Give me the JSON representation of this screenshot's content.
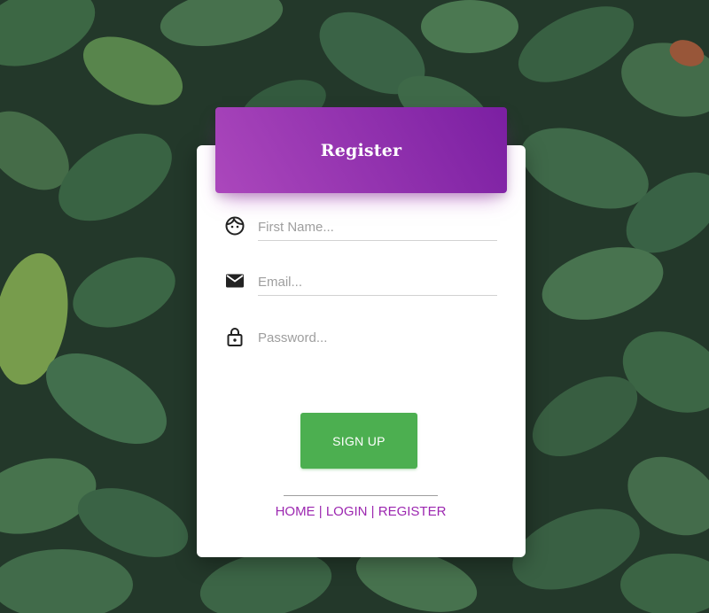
{
  "header": {
    "title": "Register"
  },
  "form": {
    "first_name": {
      "placeholder": "First Name...",
      "value": "",
      "icon": "face-icon"
    },
    "email": {
      "placeholder": "Email...",
      "value": "",
      "icon": "mail-icon"
    },
    "password": {
      "placeholder": "Password...",
      "value": "",
      "icon": "lock-icon"
    },
    "submit_label": "SIGN UP"
  },
  "footer": {
    "links": [
      "HOME",
      "LOGIN",
      "REGISTER"
    ],
    "separator": "|"
  },
  "colors": {
    "header_gradient_start": "#ab47bc",
    "header_gradient_end": "#7b1fa2",
    "button": "#4caf50",
    "link": "#9c27b0"
  }
}
